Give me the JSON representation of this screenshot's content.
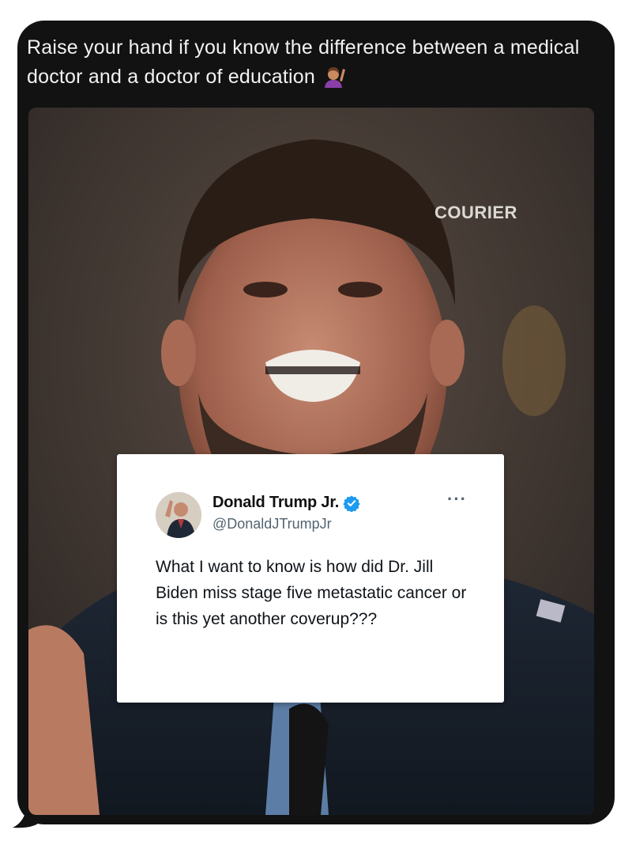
{
  "message": {
    "text": "Raise your hand if you know the difference between a medical doctor and a doctor of education",
    "emoji": "person-raising-hand-emoji"
  },
  "media": {
    "watermark": "COURIER"
  },
  "tweet": {
    "display_name": "Donald Trump Jr.",
    "handle": "@DonaldJTrumpJr",
    "more_label": "···",
    "body": "What I want to know is how did Dr. Jill Biden miss stage five metastatic cancer or is this yet another coverup???",
    "verified_color": "#1d9bf0"
  },
  "colors": {
    "bubble": "#121212",
    "message_text": "#f2f2f2"
  }
}
